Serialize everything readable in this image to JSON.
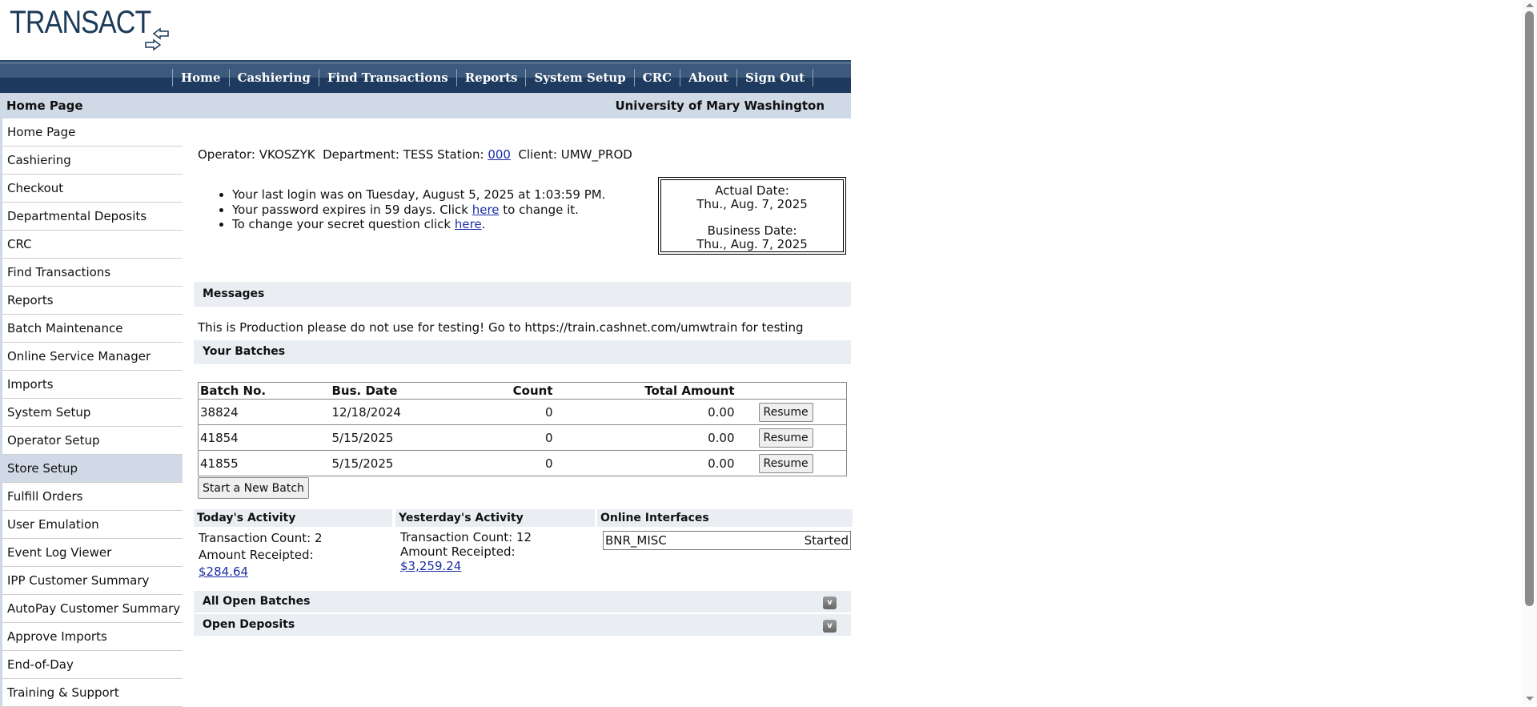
{
  "logo": {
    "text": "TRANSACT",
    "icon": "arrows-exchange-icon"
  },
  "nav": [
    "Home",
    "Cashiering",
    "Find Transactions",
    "Reports",
    "System Setup",
    "CRC",
    "About",
    "Sign Out"
  ],
  "header": {
    "page": "Home Page",
    "institution": "University of Mary Washington"
  },
  "sidebar": [
    "Home Page",
    "Cashiering",
    "Checkout",
    "Departmental Deposits",
    "CRC",
    "Find Transactions",
    "Reports",
    "Batch Maintenance",
    "Online Service Manager",
    "Imports",
    "System Setup",
    "Operator Setup",
    "Store Setup",
    "Fulfill Orders",
    "User Emulation",
    "Event Log Viewer",
    "IPP Customer Summary",
    "AutoPay Customer Summary",
    "Approve Imports",
    "End-of-Day",
    "Training & Support"
  ],
  "sidebar_active": "Store Setup",
  "info": {
    "operator_label": "Operator: VKOSZYK  Department: TESS Station: ",
    "station": "000",
    "client": "  Client: UMW_PROD"
  },
  "notices": {
    "last_login": "Your last login was on Tuesday, August 5, 2025 at 1:03:59 PM.",
    "pw_pre": "Your password expires in 59 days. Click ",
    "pw_link": "here",
    "pw_post": " to change it.",
    "sq_pre": "To change your secret question click ",
    "sq_link": "here",
    "sq_post": "."
  },
  "dates": {
    "actual_label": "Actual Date:",
    "actual": "Thu., Aug. 7, 2025",
    "business_label": "Business Date:",
    "business": "Thu., Aug. 7, 2025"
  },
  "messages": {
    "title": "Messages",
    "text": "This is Production please do not use for testing! Go to https://train.cashnet.com/umwtrain for testing"
  },
  "batches": {
    "title": "Your Batches",
    "columns": [
      "Batch No.",
      "Bus. Date",
      "Count",
      "Total Amount"
    ],
    "rows": [
      [
        "38824",
        "12/18/2024",
        "0",
        "0.00"
      ],
      [
        "41854",
        "5/15/2025",
        "0",
        "0.00"
      ],
      [
        "41855",
        "5/15/2025",
        "0",
        "0.00"
      ]
    ],
    "resume": "Resume",
    "new_batch": "Start a New Batch"
  },
  "today": {
    "title": "Today's Activity",
    "count": "Transaction Count: 2",
    "amount_label": "Amount Receipted:",
    "amount": "$284.64"
  },
  "yesterday": {
    "title": "Yesterday's Activity",
    "count": "Transaction Count: 12",
    "amount_label": "Amount Receipted:",
    "amount": "$3,259.24"
  },
  "interfaces": {
    "title": "Online Interfaces",
    "name": "BNR_MISC",
    "status": "Started"
  },
  "sections": {
    "open_batches": "All Open Batches",
    "open_deposits": "Open Deposits"
  }
}
